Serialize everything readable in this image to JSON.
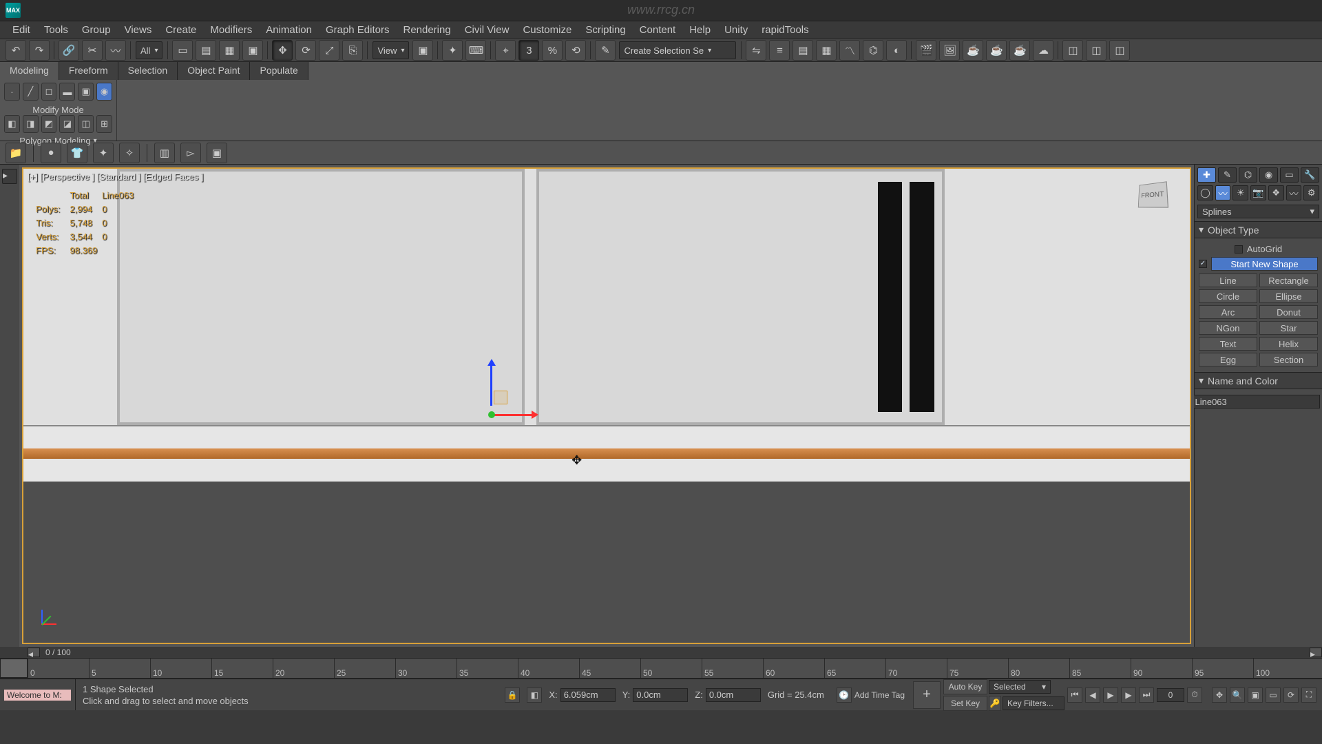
{
  "watermark_url": "www.rrcg.cn",
  "title_bar": {
    "app": "MAX"
  },
  "menu": {
    "items": [
      "Edit",
      "Tools",
      "Group",
      "Views",
      "Create",
      "Modifiers",
      "Animation",
      "Graph Editors",
      "Rendering",
      "Civil View",
      "Customize",
      "Scripting",
      "Content",
      "Help",
      "Unity",
      "rapidTools"
    ]
  },
  "toolbar": {
    "group_all": "All",
    "view": "View",
    "sel_set": "Create Selection Se"
  },
  "ribbon": {
    "tabs": [
      "Modeling",
      "Freeform",
      "Selection",
      "Object Paint",
      "Populate"
    ],
    "active_tab": 0,
    "modify_mode": "Modify Mode",
    "polygon_modeling": "Polygon Modeling"
  },
  "viewport": {
    "label": "[+] [Perspective ] [Standard ] [Edged Faces ]",
    "viewcube_face": "FRONT",
    "stats": {
      "hdr_total": "Total",
      "hdr_obj": "Line063",
      "polys_label": "Polys:",
      "polys_total": "2,994",
      "polys_obj": "0",
      "tris_label": "Tris:",
      "tris_total": "5,748",
      "tris_obj": "0",
      "verts_label": "Verts:",
      "verts_total": "3,544",
      "verts_obj": "0",
      "fps_label": "FPS:",
      "fps_val": "98.369"
    }
  },
  "cmd_panel": {
    "dropdown": "Splines",
    "rollout_objtype": "Object Type",
    "autogrid": "AutoGrid",
    "start_new_shape": "Start New Shape",
    "types": [
      [
        "Line",
        "Rectangle"
      ],
      [
        "Circle",
        "Ellipse"
      ],
      [
        "Arc",
        "Donut"
      ],
      [
        "NGon",
        "Star"
      ],
      [
        "Text",
        "Helix"
      ],
      [
        "Egg",
        "Section"
      ]
    ],
    "rollout_name": "Name and Color",
    "obj_name": "Line063"
  },
  "timeline": {
    "frame_label": "0 / 100",
    "ticks": [
      "0",
      "5",
      "10",
      "15",
      "20",
      "25",
      "30",
      "35",
      "40",
      "45",
      "50",
      "55",
      "60",
      "65",
      "70",
      "75",
      "80",
      "85",
      "90",
      "95",
      "100"
    ]
  },
  "status": {
    "welcome": "Welcome to M:",
    "sel": "1 Shape Selected",
    "prompt": "Click and drag to select and move objects",
    "x_label": "X:",
    "x_val": "6.059cm",
    "y_label": "Y:",
    "y_val": "0.0cm",
    "z_label": "Z:",
    "z_val": "0.0cm",
    "grid_label": "Grid = 25.4cm",
    "autokey": "Auto Key",
    "setkey": "Set Key",
    "selected": "Selected",
    "keyfilters": "Key Filters...",
    "addtimetag": "Add Time Tag",
    "spinner": "0"
  }
}
